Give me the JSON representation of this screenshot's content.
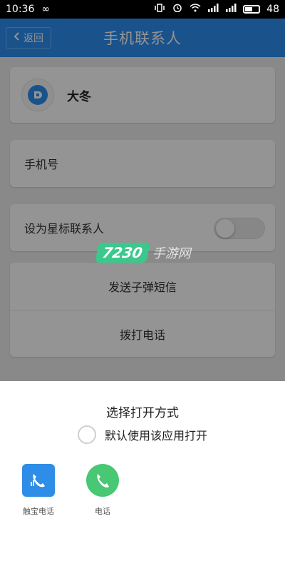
{
  "status_bar": {
    "time": "10:36",
    "battery": "48",
    "network": "4G"
  },
  "header": {
    "back_label": "返回",
    "title": "手机联系人"
  },
  "contact": {
    "name": "大冬"
  },
  "phone": {
    "label": "手机号"
  },
  "star": {
    "label": "设为星标联系人",
    "enabled": false
  },
  "actions": {
    "send_bullet_sms": "发送子弹短信",
    "call": "拨打电话"
  },
  "watermark": {
    "logo": "7230",
    "text": "手游网"
  },
  "sheet": {
    "title": "选择打开方式",
    "default_label": "默认使用该应用打开",
    "apps": [
      {
        "label": "触宝电话",
        "icon": "touchpal-dialer-icon"
      },
      {
        "label": "电话",
        "icon": "phone-icon"
      }
    ]
  },
  "colors": {
    "header_blue": "#2d8ef0",
    "dialer_blue": "#2e8de6",
    "phone_green": "#48c774",
    "watermark_green": "#3cc88c"
  }
}
